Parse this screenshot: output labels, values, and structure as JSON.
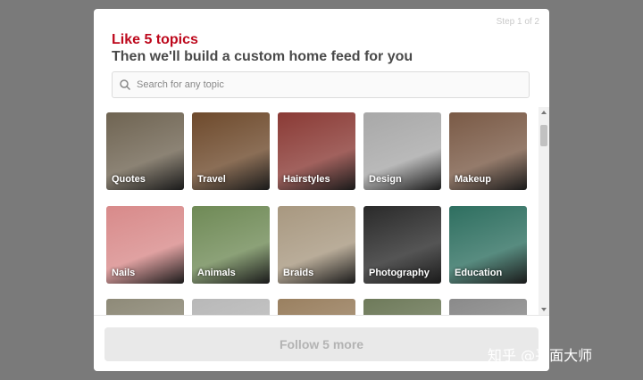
{
  "modal": {
    "step": "Step 1 of 2",
    "title": "Like 5 topics",
    "subtitle": "Then we'll build a custom home feed for you"
  },
  "search": {
    "placeholder": "Search for any topic",
    "icon": "search-icon"
  },
  "topics": [
    {
      "label": "Quotes",
      "color": "#6f6452"
    },
    {
      "label": "Travel",
      "color": "#6e4a2c"
    },
    {
      "label": "Hairstyles",
      "color": "#8a3a35"
    },
    {
      "label": "Design",
      "color": "#a8a8a8"
    },
    {
      "label": "Makeup",
      "color": "#7a5a46"
    },
    {
      "label": "Nails",
      "color": "#d88a8a"
    },
    {
      "label": "Animals",
      "color": "#6f8a56"
    },
    {
      "label": "Braids",
      "color": "#a89880"
    },
    {
      "label": "Photography",
      "color": "#2a2a2a"
    },
    {
      "label": "Education",
      "color": "#2e6f60"
    },
    {
      "label": "",
      "color": "#8e8a78"
    },
    {
      "label": "",
      "color": "#b8b8b8"
    },
    {
      "label": "",
      "color": "#9a8060"
    },
    {
      "label": "",
      "color": "#6e7a5a"
    },
    {
      "label": "",
      "color": "#8a8a8a"
    }
  ],
  "footer": {
    "follow_label": "Follow 5 more"
  },
  "watermark": "知乎 @平面大师"
}
